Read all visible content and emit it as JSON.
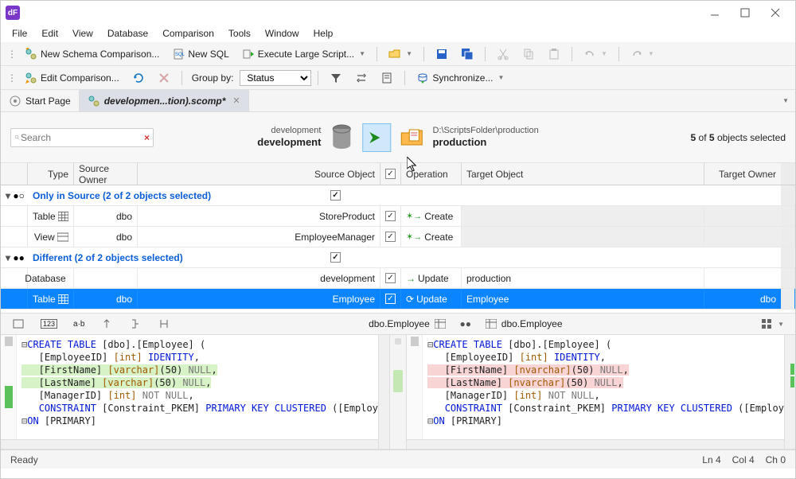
{
  "window": {
    "app_icon_text": "dF"
  },
  "menu": [
    "File",
    "Edit",
    "View",
    "Database",
    "Comparison",
    "Tools",
    "Window",
    "Help"
  ],
  "toolbar1": {
    "new_schema": "New Schema Comparison...",
    "new_sql": "New SQL",
    "execute": "Execute Large Script..."
  },
  "toolbar2": {
    "edit_comparison": "Edit Comparison...",
    "group_by_label": "Group by:",
    "group_by_value": "Status",
    "synchronize": "Synchronize..."
  },
  "tabs": {
    "start": "Start Page",
    "doc": "developmen...tion).scomp*"
  },
  "compare": {
    "src_small": "development",
    "src_big": "development",
    "tgt_path": "D:\\ScriptsFolder\\production",
    "tgt_big": "production",
    "selection_summary_a": "5",
    "selection_summary_b": "5",
    "selection_summary_suffix": "objects selected",
    "search_placeholder": "Search"
  },
  "grid": {
    "headers": {
      "type": "Type",
      "source_owner": "Source Owner",
      "source_object": "Source Object",
      "operation": "Operation",
      "target_object": "Target Object",
      "target_owner": "Target Owner"
    },
    "group1": "Only in Source (2 of 2 objects selected)",
    "group2": "Different (2 of 2 objects selected)",
    "rows": {
      "r1": {
        "type": "Table",
        "owner": "dbo",
        "sobj": "StoreProduct",
        "op": "Create"
      },
      "r2": {
        "type": "View",
        "owner": "dbo",
        "sobj": "EmployeeManager",
        "op": "Create"
      },
      "r3": {
        "type": "Database",
        "owner": "",
        "sobj": "development",
        "op": "Update",
        "tobj": "production"
      },
      "r4": {
        "type": "Table",
        "owner": "dbo",
        "sobj": "Employee",
        "op": "Update",
        "tobj": "Employee",
        "towner": "dbo"
      }
    }
  },
  "diff": {
    "left_label": "dbo.Employee",
    "right_label": "dbo.Employee"
  },
  "status": {
    "ready": "Ready",
    "ln": "Ln 4",
    "col": "Col 4",
    "ch": "Ch 0"
  },
  "icons": {
    "search": "search-icon",
    "clear": "×"
  }
}
